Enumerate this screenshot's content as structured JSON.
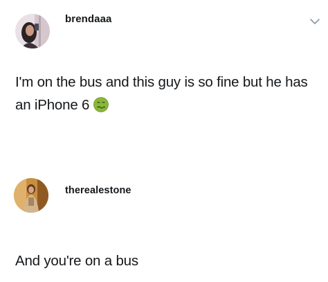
{
  "posts": [
    {
      "username": "brendaaa",
      "text": "I'm on the bus and this guy is so fine but he has an iPhone 6",
      "emoji": "nauseated-face-icon",
      "has_menu": true
    },
    {
      "username": "therealestone",
      "text": "And you're on a bus"
    }
  ],
  "colors": {
    "text": "#14171a",
    "chevron": "#8899a6",
    "emoji_green": "#8ab73b"
  }
}
